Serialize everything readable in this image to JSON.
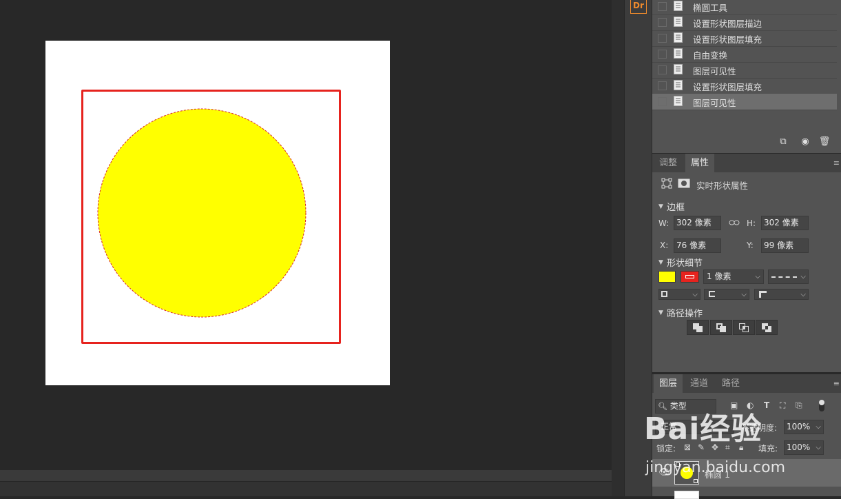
{
  "history": {
    "items": [
      {
        "label": "椭圆工具"
      },
      {
        "label": "设置形状图层描边"
      },
      {
        "label": "设置形状图层填充"
      },
      {
        "label": "自由变换"
      },
      {
        "label": "图层可见性"
      },
      {
        "label": "设置形状图层填充"
      },
      {
        "label": "图层可见性",
        "active": true
      }
    ]
  },
  "dock": {
    "dr_label": "Dr"
  },
  "properties": {
    "tabs": [
      "调整",
      "属性"
    ],
    "active_tab": "属性",
    "title": "实时形状属性",
    "bounds_section": "边框",
    "w_label": "W:",
    "w_value": "302 像素",
    "h_label": "H:",
    "h_value": "302 像素",
    "x_label": "X:",
    "x_value": "76 像素",
    "y_label": "Y:",
    "y_value": "99 像素",
    "shape_section": "形状细节",
    "stroke_width": "1 像素",
    "fill_color": "#ffff00",
    "stroke_color": "#e6231e",
    "path_section": "路径操作"
  },
  "layers": {
    "tabs": [
      "图层",
      "通道",
      "路径"
    ],
    "active_tab": "图层",
    "filter_kind": "类型",
    "blend_mode": "正常",
    "opacity_label": "不透明度:",
    "opacity_value": "100%",
    "lock_label": "锁定:",
    "fill_label": "填充:",
    "fill_value": "100%",
    "layer_name": "椭圆 1"
  },
  "watermark": {
    "brand": "Bai经验",
    "url": "jingyan.baidu.com"
  }
}
